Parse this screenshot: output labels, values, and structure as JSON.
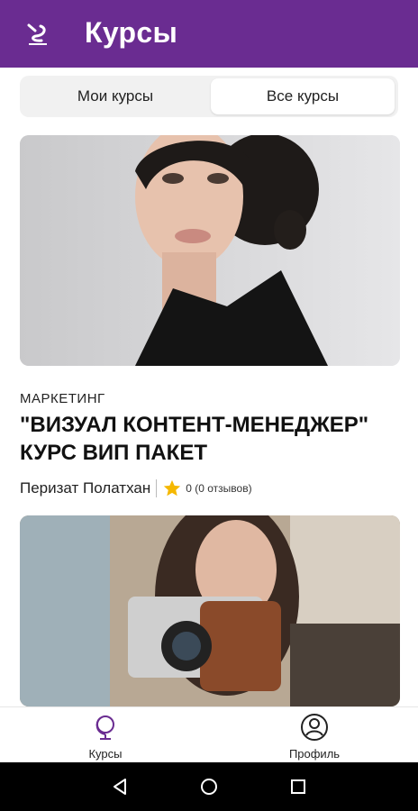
{
  "header": {
    "title": "Курсы",
    "color": "#6a2c91"
  },
  "tabs": [
    {
      "label": "Мои курсы",
      "selected": false
    },
    {
      "label": "Все курсы",
      "selected": true
    }
  ],
  "courses": [
    {
      "category": "МАРКЕТИНГ",
      "title": "\"ВИЗУАЛ КОНТЕНТ-МЕНЕДЖЕР\" КУРС ВИП ПАКЕТ",
      "author": "Перизат Полатхан",
      "rating": "0 (0 отзывов)"
    }
  ],
  "bottom_nav": [
    {
      "label": "Курсы",
      "icon": "globe-icon",
      "active": true
    },
    {
      "label": "Профиль",
      "icon": "profile-icon",
      "active": false
    }
  ],
  "colors": {
    "accent": "#6a2c91",
    "star": "#f5b800"
  }
}
